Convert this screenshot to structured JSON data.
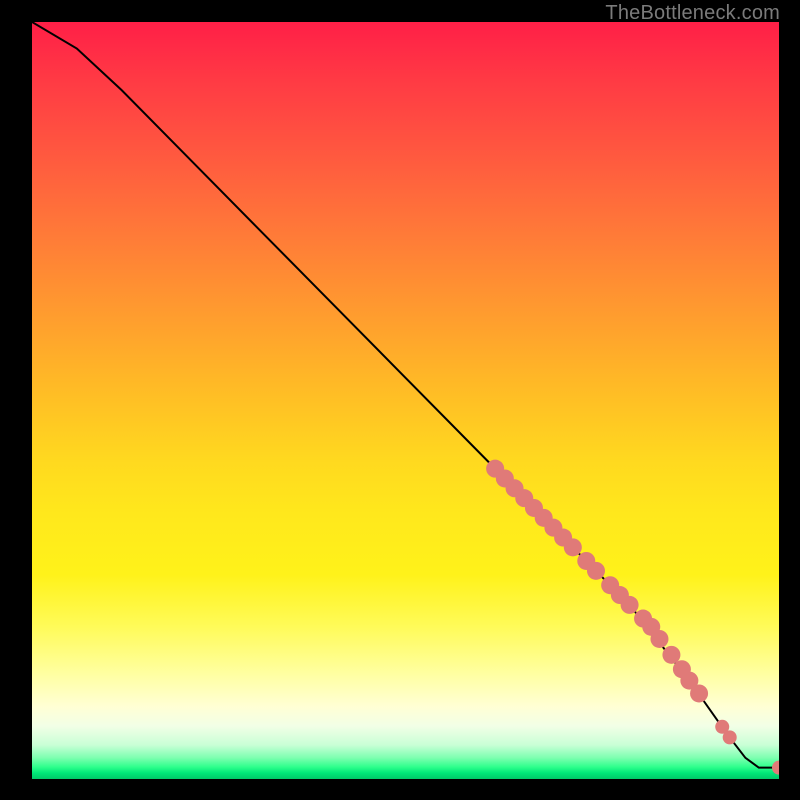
{
  "watermark": "TheBottleneck.com",
  "chart_data": {
    "type": "line",
    "title": "",
    "xlabel": "",
    "ylabel": "",
    "xlim": [
      0,
      100
    ],
    "ylim": [
      0,
      100
    ],
    "grid": false,
    "curve": [
      {
        "x": 0,
        "y": 100
      },
      {
        "x": 6,
        "y": 96.5
      },
      {
        "x": 12,
        "y": 91
      },
      {
        "x": 20,
        "y": 83
      },
      {
        "x": 30,
        "y": 73
      },
      {
        "x": 40,
        "y": 63
      },
      {
        "x": 50,
        "y": 53
      },
      {
        "x": 60,
        "y": 43
      },
      {
        "x": 70,
        "y": 33
      },
      {
        "x": 80,
        "y": 23
      },
      {
        "x": 88,
        "y": 13
      },
      {
        "x": 93,
        "y": 6
      },
      {
        "x": 95.5,
        "y": 2.8
      },
      {
        "x": 97.3,
        "y": 1.5
      },
      {
        "x": 100,
        "y": 1.5
      }
    ],
    "points": [
      {
        "x": 62,
        "y": 41.0
      },
      {
        "x": 63.3,
        "y": 39.7
      },
      {
        "x": 64.6,
        "y": 38.4
      },
      {
        "x": 65.9,
        "y": 37.1
      },
      {
        "x": 67.2,
        "y": 35.8
      },
      {
        "x": 68.5,
        "y": 34.5
      },
      {
        "x": 69.8,
        "y": 33.2
      },
      {
        "x": 71.1,
        "y": 31.9
      },
      {
        "x": 72.4,
        "y": 30.6
      },
      {
        "x": 74.2,
        "y": 28.8
      },
      {
        "x": 75.5,
        "y": 27.5
      },
      {
        "x": 77.4,
        "y": 25.6
      },
      {
        "x": 78.7,
        "y": 24.3
      },
      {
        "x": 80.0,
        "y": 23.0
      },
      {
        "x": 81.8,
        "y": 21.2
      },
      {
        "x": 82.9,
        "y": 20.1
      },
      {
        "x": 84.0,
        "y": 18.5
      },
      {
        "x": 85.6,
        "y": 16.4
      },
      {
        "x": 87.0,
        "y": 14.5
      },
      {
        "x": 88.0,
        "y": 13.0
      },
      {
        "x": 89.3,
        "y": 11.3
      },
      {
        "x": 92.4,
        "y": 6.9
      },
      {
        "x": 93.4,
        "y": 5.5
      },
      {
        "x": 100,
        "y": 1.5
      }
    ],
    "point_color": "#e07a78",
    "curve_color": "#000000",
    "point_radius_primary": 9,
    "point_radius_small": 7
  }
}
